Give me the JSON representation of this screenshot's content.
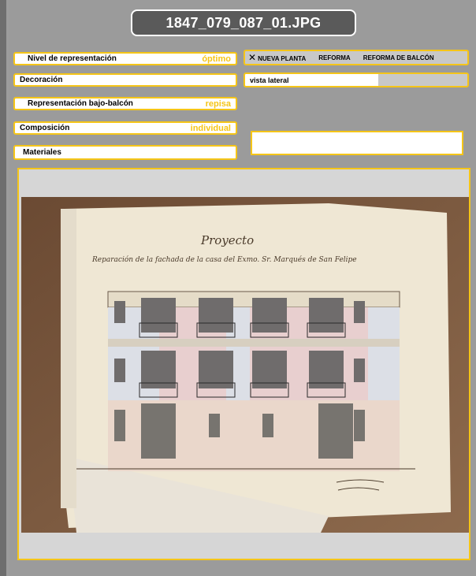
{
  "title": "1847_079_087_01.JPG",
  "fields": {
    "nivel": {
      "label": "Nivel de representación",
      "value": "óptimo"
    },
    "decoracion": {
      "label": "Decoración",
      "value": ""
    },
    "bajo_balcon": {
      "label": "Representación bajo-balcón",
      "value": "repisa"
    },
    "composicion": {
      "label": "Composición",
      "value": "individual"
    },
    "materiales": {
      "label": "Materiales",
      "value": ""
    }
  },
  "tags": {
    "mark": "✕",
    "items": [
      "NUEVA PLANTA",
      "REFORMA",
      "REFORMA DE BALCÓN"
    ]
  },
  "vista": "vista lateral",
  "drawing": {
    "heading": "Proyecto",
    "subheading": "Reparación de la fachada de la casa del Exmo. Sr. Marqués de San Felipe"
  },
  "colors": {
    "accent": "#f5c518",
    "title_bg": "#5a5a5a"
  }
}
